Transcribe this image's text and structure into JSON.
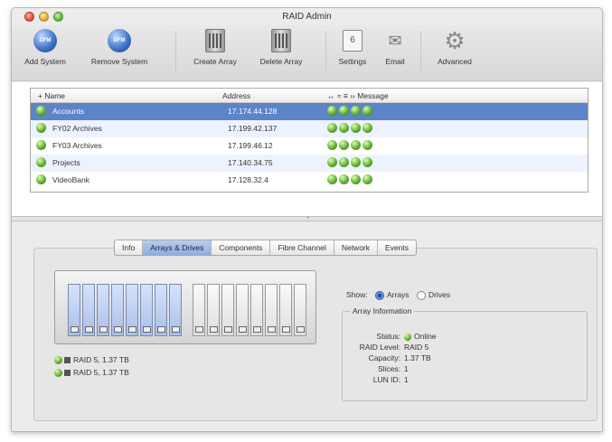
{
  "window": {
    "title": "RAID Admin"
  },
  "toolbar": {
    "add_system": "Add System",
    "remove_system": "Remove System",
    "create_array": "Create Array",
    "delete_array": "Delete Array",
    "settings": "Settings",
    "email": "Email",
    "advanced": "Advanced",
    "icon_text": "DFM",
    "settings_glyph": "6"
  },
  "table": {
    "col_name": "+ Name",
    "col_address": "Address",
    "col_status": "↔ ≈ ≡ ›› Message",
    "rows": [
      {
        "name": "Accounts",
        "address": "17.174.44.128"
      },
      {
        "name": "FY02 Archives",
        "address": "17.199.42.137"
      },
      {
        "name": "FY03 Archives",
        "address": "17.199.46.12"
      },
      {
        "name": "Projects",
        "address": "17.140.34.75"
      },
      {
        "name": "VideoBank",
        "address": "17.128.32.4"
      }
    ]
  },
  "tabs": [
    "Info",
    "Arrays & Drives",
    "Components",
    "Fibre Channel",
    "Network",
    "Events"
  ],
  "arrays_panel": {
    "array_lines": [
      "RAID 5, 1.37 TB",
      "RAID 5, 1.37 TB"
    ],
    "show_label": "Show:",
    "radio_arrays": "Arrays",
    "radio_drives": "Drives",
    "group_title": "Array Information",
    "info": {
      "status_label": "Status:",
      "status_value": "Online",
      "raid_label": "RAID Level:",
      "raid_value": "RAID 5",
      "capacity_label": "Capacity:",
      "capacity_value": "1.37 TB",
      "slices_label": "Slices:",
      "slices_value": "1",
      "lun_label": "LUN ID:",
      "lun_value": "1"
    }
  },
  "colors": {
    "selection": "#5b84c9",
    "status_green": "#5aa82a",
    "active_tab": "#9bb8e6"
  },
  "icons": [
    "globe-icon",
    "drive-array-icon",
    "settings-icon",
    "email-icon",
    "gear-icon",
    "status-dot-icon"
  ]
}
